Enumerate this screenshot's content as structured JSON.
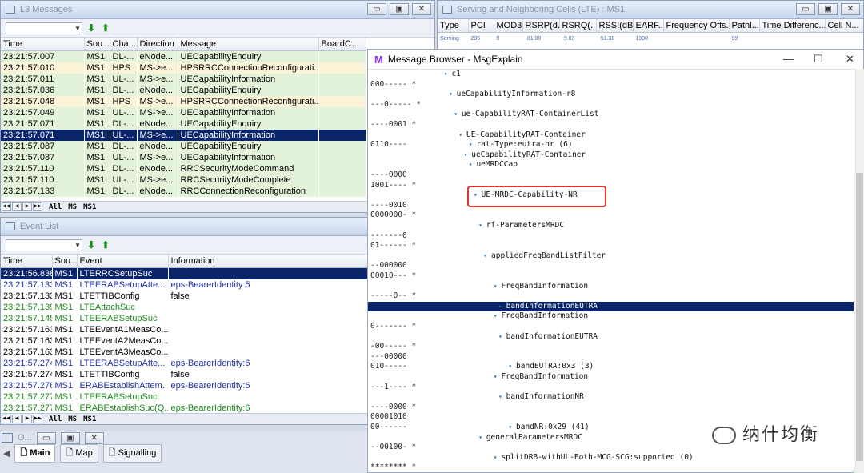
{
  "l3": {
    "title": "L3 Messages",
    "columns": [
      "Time",
      "Sou...",
      "Cha...",
      "Direction",
      "Message",
      "BoardC..."
    ],
    "rows": [
      {
        "time": "23:21:57.007",
        "src": "MS1",
        "ch": "DL-...",
        "dir": "eNode...",
        "msg": "UECapabilityEnquiry",
        "style": "grn"
      },
      {
        "time": "23:21:57.010",
        "src": "MS1",
        "ch": "HPS",
        "dir": "MS->e...",
        "msg": "HPSRRCConnectionReconfigurati...",
        "style": "tan"
      },
      {
        "time": "23:21:57.011",
        "src": "MS1",
        "ch": "UL-...",
        "dir": "MS->e...",
        "msg": "UECapabilityInformation",
        "style": "grn"
      },
      {
        "time": "23:21:57.036",
        "src": "MS1",
        "ch": "DL-...",
        "dir": "eNode...",
        "msg": "UECapabilityEnquiry",
        "style": "grn"
      },
      {
        "time": "23:21:57.048",
        "src": "MS1",
        "ch": "HPS",
        "dir": "MS->e...",
        "msg": "HPSRRCConnectionReconfigurati...",
        "style": "tan"
      },
      {
        "time": "23:21:57.049",
        "src": "MS1",
        "ch": "UL-...",
        "dir": "MS->e...",
        "msg": "UECapabilityInformation",
        "style": "grn"
      },
      {
        "time": "23:21:57.071",
        "src": "MS1",
        "ch": "DL-...",
        "dir": "eNode...",
        "msg": "UECapabilityEnquiry",
        "style": "grn"
      },
      {
        "time": "23:21:57.071",
        "src": "MS1",
        "ch": "UL-...",
        "dir": "MS->e...",
        "msg": "UECapabilityInformation",
        "style": "sel"
      },
      {
        "time": "23:21:57.087",
        "src": "MS1",
        "ch": "DL-...",
        "dir": "eNode...",
        "msg": "UECapabilityEnquiry",
        "style": "grn"
      },
      {
        "time": "23:21:57.087",
        "src": "MS1",
        "ch": "UL-...",
        "dir": "MS->e...",
        "msg": "UECapabilityInformation",
        "style": "grn"
      },
      {
        "time": "23:21:57.110",
        "src": "MS1",
        "ch": "DL-...",
        "dir": "eNode...",
        "msg": "RRCSecurityModeCommand",
        "style": "grn"
      },
      {
        "time": "23:21:57.110",
        "src": "MS1",
        "ch": "UL-...",
        "dir": "MS->e...",
        "msg": "RRCSecurityModeComplete",
        "style": "grn"
      },
      {
        "time": "23:21:57.133",
        "src": "MS1",
        "ch": "DL-...",
        "dir": "eNode...",
        "msg": "RRCConnectionReconfiguration",
        "style": "grn"
      }
    ],
    "tabs": [
      "All",
      "MS",
      "MS1"
    ]
  },
  "cells": {
    "title": "Serving and Neighboring Cells (LTE) : MS1",
    "columns": [
      "Type",
      "PCI",
      "MOD3",
      "RSRP(d...",
      "RSRQ(...",
      "RSSI(dB...",
      "EARF...",
      "Frequency Offs...",
      "Pathl...",
      "Time Differenc...",
      "Cell N..."
    ],
    "row": [
      "Serving",
      "285",
      "0",
      "-81.00",
      "-9.63",
      "-51.38",
      "1300",
      "",
      "99",
      "",
      ""
    ]
  },
  "events": {
    "title": "Event List",
    "columns": [
      "Time",
      "Sou...",
      "Event",
      "Information"
    ],
    "rows": [
      {
        "time": "23:21:56.838",
        "src": "MS1",
        "ev": "LTERRCSetupSuc",
        "info": "",
        "style": "sel"
      },
      {
        "time": "23:21:57.133",
        "src": "MS1",
        "ev": "LTEERABSetupAtte...",
        "info": "eps-BearerIdentity:5",
        "style": "blue"
      },
      {
        "time": "23:21:57.133",
        "src": "MS1",
        "ev": "LTETTIBConfig",
        "info": "false",
        "style": "black"
      },
      {
        "time": "23:21:57.139",
        "src": "MS1",
        "ev": "LTEAttachSuc",
        "info": "",
        "style": "green"
      },
      {
        "time": "23:21:57.145",
        "src": "MS1",
        "ev": "LTEERABSetupSuc",
        "info": "",
        "style": "green"
      },
      {
        "time": "23:21:57.163",
        "src": "MS1",
        "ev": "LTEEventA1MeasCo...",
        "info": "",
        "style": "black"
      },
      {
        "time": "23:21:57.163",
        "src": "MS1",
        "ev": "LTEEventA2MeasCo...",
        "info": "",
        "style": "black"
      },
      {
        "time": "23:21:57.163",
        "src": "MS1",
        "ev": "LTEEventA3MeasCo...",
        "info": "",
        "style": "black"
      },
      {
        "time": "23:21:57.274",
        "src": "MS1",
        "ev": "LTEERABSetupAtte...",
        "info": "eps-BearerIdentity:6",
        "style": "blue"
      },
      {
        "time": "23:21:57.274",
        "src": "MS1",
        "ev": "LTETTIBConfig",
        "info": "false",
        "style": "black"
      },
      {
        "time": "23:21:57.276",
        "src": "MS1",
        "ev": "ERABEstablishAttem...",
        "info": "eps-BearerIdentity:6",
        "style": "blue"
      },
      {
        "time": "23:21:57.277",
        "src": "MS1",
        "ev": "LTEERABSetupSuc",
        "info": "",
        "style": "green"
      },
      {
        "time": "23:21:57.277",
        "src": "MS1",
        "ev": "ERABEstablishSuc(Q...",
        "info": "eps-BearerIdentity:6",
        "style": "green"
      }
    ],
    "tabs": [
      "All",
      "MS",
      "MS1"
    ]
  },
  "bottom": {
    "title": "O...",
    "tabs": [
      "Main",
      "Map",
      "Signalling"
    ]
  },
  "browser": {
    "title": "Message Browser - MsgExplain",
    "lines": [
      {
        "bits": "",
        "node": "c1",
        "lvl": 14
      },
      {
        "bits": "000----- *",
        "node": "",
        "lvl": 0
      },
      {
        "bits": "",
        "node": "ueCapabilityInformation-r8",
        "lvl": 15
      },
      {
        "bits": "---0----- *",
        "node": "",
        "lvl": 0
      },
      {
        "bits": "",
        "node": "ue-CapabilityRAT-ContainerList",
        "lvl": 16
      },
      {
        "bits": "----0001 *",
        "node": "",
        "lvl": 0
      },
      {
        "bits": "",
        "node": "UE-CapabilityRAT-Container",
        "lvl": 17
      },
      {
        "bits": "0110----",
        "node": "rat-Type:eutra-nr (6)",
        "lvl": 19
      },
      {
        "bits": "",
        "node": "ueCapabilityRAT-Container",
        "lvl": 18
      },
      {
        "bits": "",
        "node": "ueMRDCCap",
        "lvl": 19
      },
      {
        "bits": "----0000",
        "node": "",
        "lvl": 0
      },
      {
        "bits": "1001---- *",
        "node": "",
        "lvl": 0
      },
      {
        "bits": "",
        "node": "UE-MRDC-Capability-NR",
        "lvl": 20
      },
      {
        "bits": "----0010",
        "node": "",
        "lvl": 0
      },
      {
        "bits": "0000000- *",
        "node": "",
        "lvl": 0
      },
      {
        "bits": "",
        "node": "rf-ParametersMRDC",
        "lvl": 21
      },
      {
        "bits": "-------0",
        "node": "",
        "lvl": 0
      },
      {
        "bits": "01------ *",
        "node": "",
        "lvl": 0
      },
      {
        "bits": "",
        "node": "appliedFreqBandListFilter",
        "lvl": 22
      },
      {
        "bits": "--000000",
        "node": "",
        "lvl": 0
      },
      {
        "bits": "00010--- *",
        "node": "",
        "lvl": 0
      },
      {
        "bits": "",
        "node": "FreqBandInformation",
        "lvl": 24
      },
      {
        "bits": "-----0-- *",
        "node": "",
        "lvl": 0
      },
      {
        "bits": "",
        "node": "bandInformationEUTRA",
        "lvl": 25
      },
      {
        "bits": "",
        "node": "FreqBandInformation",
        "lvl": 24
      },
      {
        "bits": "0------- *",
        "node": "",
        "lvl": 0
      },
      {
        "bits": "",
        "node": "bandInformationEUTRA",
        "lvl": 25
      },
      {
        "bits": "-00----- *",
        "node": "",
        "lvl": 0
      },
      {
        "bits": "---00000",
        "node": "",
        "lvl": 0
      },
      {
        "bits": "010-----",
        "node": "bandEUTRA:0x3 (3)",
        "lvl": 27
      },
      {
        "bits": "",
        "node": "FreqBandInformation",
        "lvl": 24
      },
      {
        "bits": "---1---- *",
        "node": "",
        "lvl": 0
      },
      {
        "bits": "",
        "node": "bandInformationNR",
        "lvl": 25
      },
      {
        "bits": "----0000 *",
        "node": "",
        "lvl": 0
      },
      {
        "bits": "00001010",
        "node": "",
        "lvl": 0
      },
      {
        "bits": "00------",
        "node": "bandNR:0x29 (41)",
        "lvl": 27
      },
      {
        "bits": "",
        "node": "generalParametersMRDC",
        "lvl": 21
      },
      {
        "bits": "--00100- *",
        "node": "",
        "lvl": 0
      },
      {
        "bits": "",
        "node": "splitDRB-withUL-Both-MCG-SCG:supported (0)",
        "lvl": 24
      },
      {
        "bits": "******** *",
        "node": "",
        "lvl": 0
      }
    ]
  },
  "watermark": "纳什均衡"
}
